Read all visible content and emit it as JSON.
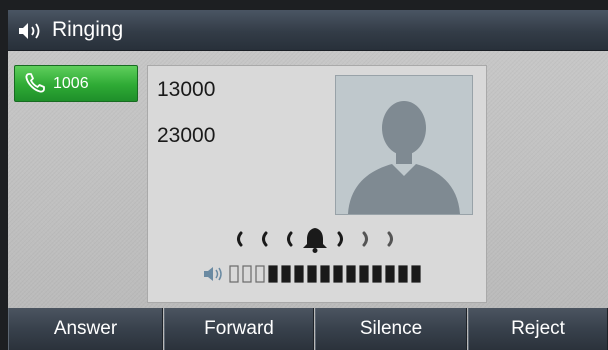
{
  "titlebar": {
    "title": "Ringing",
    "icon": "speaker-icon"
  },
  "linekey": {
    "label": "1006",
    "icon": "phone-handset-icon",
    "color": "#2eaa35"
  },
  "call": {
    "caller_number": "13000",
    "caller_secondary": "23000",
    "avatar": "person-silhouette-icon",
    "ring_indicator": "bell-icon"
  },
  "volume": {
    "level": 12,
    "max": 15,
    "icon": "speaker-volume-icon"
  },
  "softkeys": [
    {
      "label": "Answer"
    },
    {
      "label": "Forward"
    },
    {
      "label": "Silence"
    },
    {
      "label": "Reject"
    }
  ]
}
